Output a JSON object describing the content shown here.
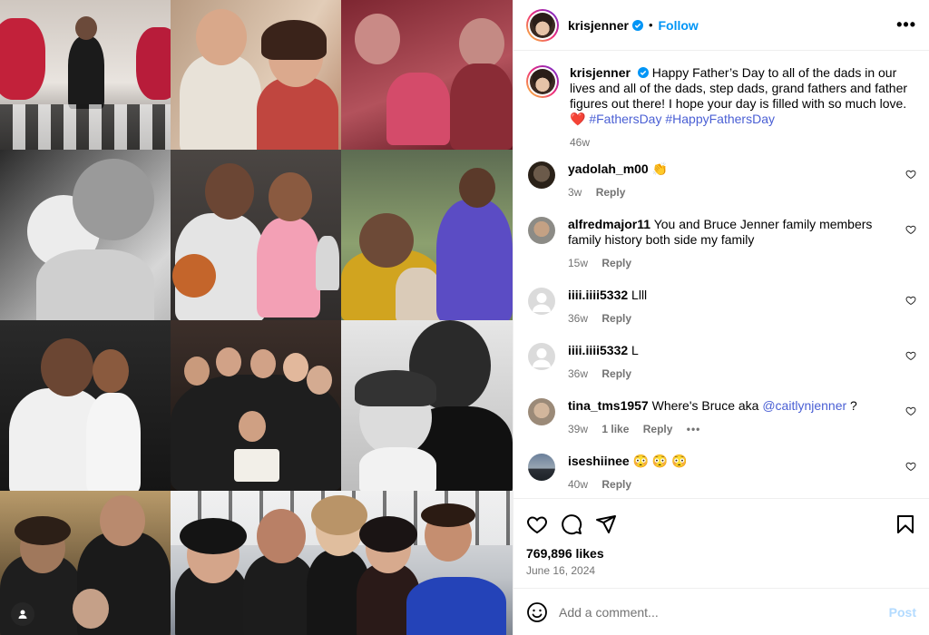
{
  "post": {
    "author": "krisjenner",
    "follow_label": "Follow",
    "more_label": "•••",
    "caption_text": "Happy Father’s Day to all of the dads in our lives and all of the dads, step dads, grand fathers and father figures out there! I hope your day is filled with so much love. ",
    "caption_heart": "❤️",
    "hashtag_1": "#FathersDay",
    "hashtag_2": "#HappyFathersDay",
    "caption_time": "46w",
    "likes": "769,896 likes",
    "date": "June 16, 2024"
  },
  "comments": [
    {
      "user": "yadolah_m00",
      "text": "👏",
      "time": "3w",
      "reply": "Reply",
      "likes": ""
    },
    {
      "user": "alfredmajor11",
      "text": "You and Bruce Jenner family members family history both side my family",
      "time": "15w",
      "reply": "Reply",
      "likes": ""
    },
    {
      "user": "iiii.iiii5332",
      "text": "Llll",
      "time": "36w",
      "reply": "Reply",
      "likes": ""
    },
    {
      "user": "iiii.iiii5332",
      "text": "L",
      "time": "36w",
      "reply": "Reply",
      "likes": ""
    },
    {
      "user": "tina_tms1957",
      "text": "Where's Bruce aka ",
      "mention": "@caitlynjenner",
      "text_after": " ?",
      "time": "39w",
      "reply": "Reply",
      "likes": "1 like",
      "more": "•••"
    },
    {
      "user": "iseshiinee",
      "text": "😳 😳 😳",
      "time": "40w",
      "reply": "Reply",
      "likes": ""
    }
  ],
  "composer": {
    "placeholder": "Add a comment...",
    "post_label": "Post"
  },
  "colors": {
    "accent": "#0095f6",
    "link": "#4a5fd4",
    "muted": "#737373",
    "heart": "#e0245e"
  }
}
